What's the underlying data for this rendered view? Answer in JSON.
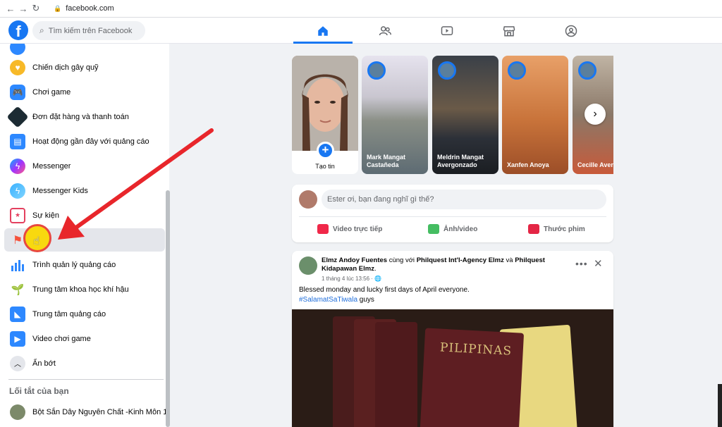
{
  "browser": {
    "url": "facebook.com"
  },
  "header": {
    "logo": "f",
    "search_placeholder": "Tìm kiếm trên Facebook",
    "tabs": [
      "home",
      "friends",
      "watch",
      "marketplace",
      "groups"
    ]
  },
  "sidebar": {
    "items": [
      {
        "label": "Chiến dịch gây quỹ",
        "icon": "heart-icon",
        "color": "#f06f3d"
      },
      {
        "label": "Chơi game",
        "icon": "gamepad-icon",
        "color": "#2d88ff"
      },
      {
        "label": "Đơn đặt hàng và thanh toán",
        "icon": "cart-icon",
        "color": "#1c2b33"
      },
      {
        "label": "Hoạt động gần đây với quảng cáo",
        "icon": "ad-activity-icon",
        "color": "#2d88ff"
      },
      {
        "label": "Messenger",
        "icon": "messenger-icon",
        "color": "#a033ff"
      },
      {
        "label": "Messenger Kids",
        "icon": "messenger-kids-icon",
        "color": "#3ab1ff"
      },
      {
        "label": "Sự kiện",
        "icon": "calendar-icon",
        "color": "#e4405f"
      },
      {
        "label": "",
        "icon": "flag-icon",
        "color": "#f5533d"
      },
      {
        "label": "Trình quản lý quảng cáo",
        "icon": "bar-chart-icon",
        "color": "#2d88ff"
      },
      {
        "label": "Trung tâm khoa học khí hậu",
        "icon": "plant-icon",
        "color": "#45bd62"
      },
      {
        "label": "Trung tâm quảng cáo",
        "icon": "megaphone-icon",
        "color": "#2d88ff"
      },
      {
        "label": "Video chơi game",
        "icon": "gaming-video-icon",
        "color": "#2d88ff"
      },
      {
        "label": "Ẩn bớt",
        "icon": "chevron-up-icon",
        "color": "#e4e6eb"
      }
    ],
    "shortcuts_title": "Lối tắt của bạn",
    "shortcut": {
      "label": "Bột Sắn Dây Nguyên Chất -Kinh Môn 1"
    }
  },
  "stories": {
    "create_label": "Tạo tin",
    "items": [
      {
        "name": "Mark Mangat Castañeda",
        "color": "#8a9aa8"
      },
      {
        "name": "Meldrin Mangat Avergonzado",
        "color": "#4b5560"
      },
      {
        "name": "Xanfen Anoya",
        "color": "#c8733a"
      },
      {
        "name": "Cecille Aver",
        "color": "#9a8a7a"
      }
    ]
  },
  "composer": {
    "placeholder": "Ester ơi, bạn đang nghĩ gì thế?",
    "live_label": "Video trực tiếp",
    "photo_label": "Ảnh/video",
    "reel_label": "Thước phim",
    "colors": {
      "live": "#f02849",
      "photo": "#45bd62",
      "reel": "#e42645"
    }
  },
  "post": {
    "author": "Elmz Andoy Fuentes",
    "with_text": " cùng với ",
    "tagged1": "Philquest Int'l-Agency Elmz",
    "and_text": " và ",
    "tagged2": "Philquest Kidapawan Elmz",
    "period": ".",
    "time": "1 tháng 4 lúc 13:56 · ",
    "globe": "🌐",
    "text": "Blessed monday and lucky  first days of April everyone.",
    "hashtag": "#SalamatSaTiwala",
    "tag_suffix": " guys",
    "image_text": "PILIPINAS"
  }
}
